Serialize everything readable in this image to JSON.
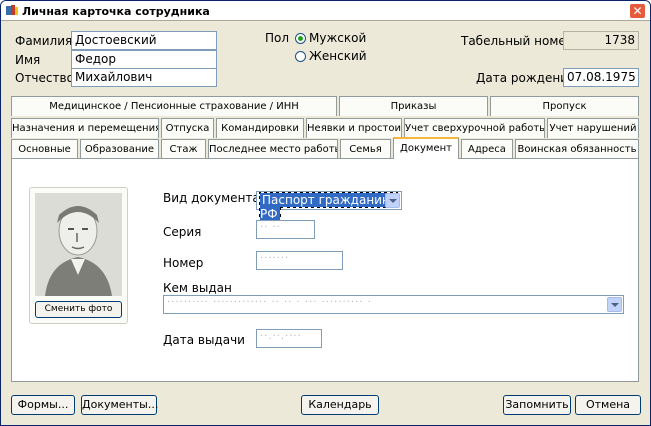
{
  "window": {
    "title": "Личная карточка сотрудника",
    "close_label": "✕"
  },
  "person": {
    "surname_label": "Фамилия",
    "surname": "Достоевский",
    "name_label": "Имя",
    "name": "Федор",
    "patronymic_label": "Отчество",
    "patronymic": "Михайлович",
    "gender_label": "Пол",
    "gender_male": "Мужской",
    "gender_female": "Женский",
    "tab_number_label": "Табельный номер",
    "tab_number": "1738",
    "birth_label": "Дата рождения",
    "birth_date": "07.08.1975"
  },
  "tabs_row1": [
    "Медицинское / Пенсионные страхование / ИНН",
    "Приказы",
    "Пропуск"
  ],
  "tabs_row2": [
    "Назначения и перемещения",
    "Отпуска",
    "Командировки",
    "Неявки и простои",
    "Учет сверхурочной работы",
    "Учет нарушений"
  ],
  "tabs_row3": [
    "Основные",
    "Образование",
    "Стаж",
    "Последнее место работы",
    "Семья",
    "Документ",
    "Адреса",
    "Воинская обязанность"
  ],
  "document": {
    "change_photo": "Сменить фото",
    "doc_type_label": "Вид документа",
    "doc_type": "Паспорт гражданина РФ",
    "series_label": "Серия",
    "series": "·· ··",
    "number_label": "Номер",
    "number": "·······",
    "issued_by_label": "Кем выдан",
    "issued_by": "·········· ············· ·· ·· · ··· ·········· ·",
    "issue_date_label": "Дата выдачи",
    "issue_date": "··.··.····"
  },
  "bottom": {
    "forms": "Формы...",
    "documents": "Документы...",
    "calendar": "Календарь",
    "save": "Запомнить",
    "cancel": "Отмена"
  }
}
